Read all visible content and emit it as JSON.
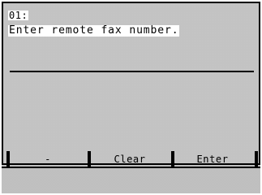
{
  "screen": {
    "title": "01:",
    "prompt": "Enter remote fax number.",
    "entry_value": ""
  },
  "softkeys": [
    {
      "label": "-"
    },
    {
      "label": "Clear"
    },
    {
      "label": "Enter"
    }
  ],
  "colors": {
    "background": "#cfcfcf",
    "text": "#000000",
    "line": "#000000"
  }
}
